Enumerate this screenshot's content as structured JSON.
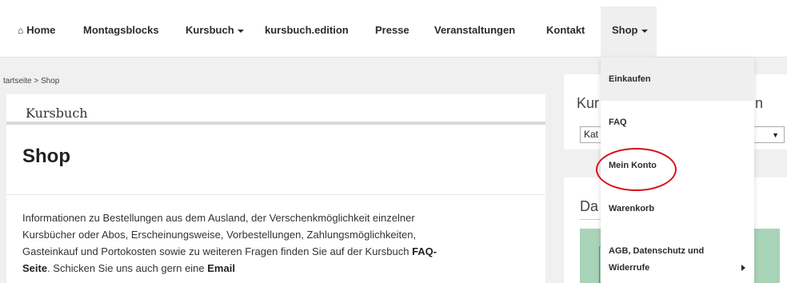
{
  "nav": {
    "home": "Home",
    "montagsblocks": "Montagsblocks",
    "kursbuch": "Kursbuch",
    "edition": "kursbuch.edition",
    "presse": "Presse",
    "veranstaltungen": "Veranstaltungen",
    "kontakt": "Kontakt",
    "shop": "Shop"
  },
  "breadcrumb": "tartseite > Shop",
  "main": {
    "section_label": "Kursbuch",
    "page_title": "Shop",
    "intro_line1": "Informationen zu Bestellungen aus dem Ausland, der Verschenkmöglichkeit einzelner",
    "intro_line2": "Kursbücher oder Abos, Erscheinungsweise, Vorbestellungen, Zahlungsmöglichkeiten,",
    "intro_line3_pre": "Gasteinkauf und Portokosten sowie zu weiteren Fragen finden Sie auf der Kursbuch ",
    "intro_line3_link": "FAQ-",
    "intro_line4_link": "Seite",
    "intro_line4_mid": ". Schicken Sie uns auch gern eine ",
    "intro_line4_link2": "Email"
  },
  "sidebar": {
    "widget1_title_start": "Kur",
    "widget1_title_end": "n",
    "select_value": "Kat",
    "widget2_title": "Da"
  },
  "dropdown": {
    "items": [
      "Einkaufen",
      "FAQ",
      "Mein Konto",
      "Warenkorb",
      "AGB, Datenschutz und",
      "Widerrufe"
    ]
  },
  "colors": {
    "highlight_ellipse": "#d6101a",
    "sidebar_image": "#a9d3b7"
  }
}
